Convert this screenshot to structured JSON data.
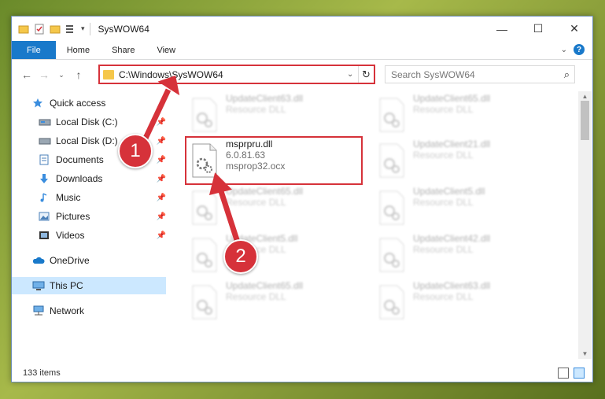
{
  "titlebar": {
    "title": "SysWOW64",
    "controls": [
      "—",
      "☐",
      "✕"
    ]
  },
  "ribbon": {
    "tabs": [
      "File",
      "Home",
      "Share",
      "View"
    ],
    "help": "?"
  },
  "address": {
    "path": "C:\\Windows\\SysWOW64",
    "search_placeholder": "Search SysWOW64"
  },
  "nav": {
    "items": [
      {
        "label": "Quick access",
        "icon": "star-icon"
      },
      {
        "label": "Local Disk (C:)",
        "icon": "drive-icon"
      },
      {
        "label": "Local Disk (D:)",
        "icon": "drive-icon"
      },
      {
        "label": "Documents",
        "icon": "documents-icon"
      },
      {
        "label": "Downloads",
        "icon": "download-icon"
      },
      {
        "label": "Music",
        "icon": "music-icon"
      },
      {
        "label": "Pictures",
        "icon": "pictures-icon"
      },
      {
        "label": "Videos",
        "icon": "videos-icon"
      },
      {
        "label": "OneDrive",
        "icon": "cloud-icon"
      },
      {
        "label": "This PC",
        "icon": "computer-icon"
      },
      {
        "label": "Network",
        "icon": "network-icon"
      }
    ]
  },
  "files": [
    {
      "name": "UpdateClient63.dll",
      "sub1": "Resource DLL",
      "sub2": ""
    },
    {
      "name": "UpdateClient65.dll",
      "sub1": "Resource DLL",
      "sub2": ""
    },
    {
      "name": "msprpru.dll",
      "sub1": "6.0.81.63",
      "sub2": "msprop32.ocx"
    },
    {
      "name": "UpdateClient21.dll",
      "sub1": "Resource DLL",
      "sub2": ""
    },
    {
      "name": "UpdateClient65.dll",
      "sub1": "Resource DLL",
      "sub2": ""
    },
    {
      "name": "UpdateClient5.dll",
      "sub1": "Resource DLL",
      "sub2": ""
    },
    {
      "name": "UpdateClient5.dll",
      "sub1": "Resource DLL",
      "sub2": ""
    },
    {
      "name": "UpdateClient42.dll",
      "sub1": "Resource DLL",
      "sub2": ""
    },
    {
      "name": "UpdateClient65.dll",
      "sub1": "Resource DLL",
      "sub2": ""
    },
    {
      "name": "UpdateClient63.dll",
      "sub1": "Resource DLL",
      "sub2": ""
    }
  ],
  "status": {
    "count": "133 items"
  },
  "callouts": [
    "1",
    "2"
  ],
  "colors": {
    "accent": "#1979ca",
    "highlight": "#d6323a",
    "selected": "#cce8ff"
  }
}
